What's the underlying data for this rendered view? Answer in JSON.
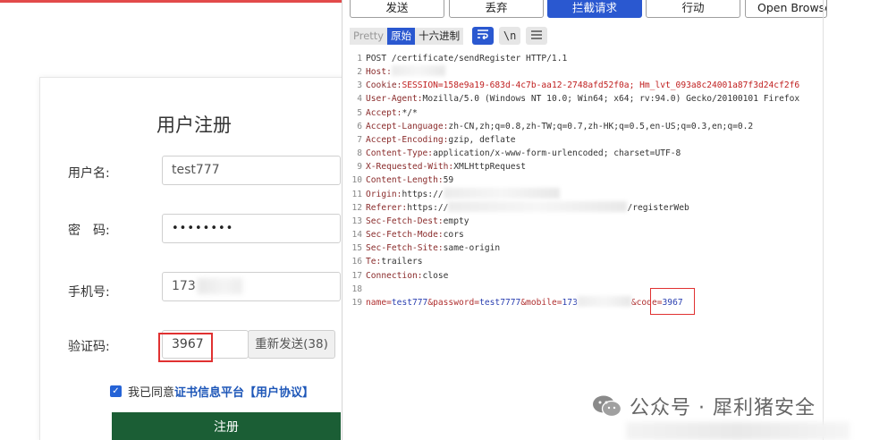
{
  "register": {
    "title": "用户注册",
    "username_label": "用户名:",
    "username_value": "test777",
    "password_label": "密　码:",
    "password_value": "••••••••",
    "mobile_label": "手机号:",
    "mobile_value": "173",
    "code_label": "验证码:",
    "code_value": "3967",
    "resend_label": "重新发送(38)",
    "agree_prefix": "我已同意",
    "agree_link": "证书信息平台【用户协议】",
    "submit_label": "注册"
  },
  "proxy": {
    "actions": [
      "发送",
      "丢弃",
      "拦截请求",
      "行动",
      "Open Browser"
    ],
    "view_tabs": [
      "Pretty",
      "原始",
      "十六进制"
    ],
    "view_icons": [
      "wrap-icon",
      "newline-icon",
      "menu-icon"
    ],
    "newline_glyph": "\\n",
    "request_lines": [
      {
        "n": "1",
        "key": "",
        "value": "POST /certificate/sendRegister HTTP/1.1"
      },
      {
        "n": "2",
        "key": "Host:",
        "value": ""
      },
      {
        "n": "3",
        "key": "Cookie:",
        "value": "SESSION=158e9a19-683d-4c7b-aa12-2748afd52f0a; Hm_lvt_093a8c24001a87f3d24cf2f6"
      },
      {
        "n": "4",
        "key": "User-Agent:",
        "value": "Mozilla/5.0 (Windows NT 10.0; Win64; x64; rv:94.0) Gecko/20100101 Firefox"
      },
      {
        "n": "5",
        "key": "Accept:",
        "value": "*/*"
      },
      {
        "n": "6",
        "key": "Accept-Language:",
        "value": "zh-CN,zh;q=0.8,zh-TW;q=0.7,zh-HK;q=0.5,en-US;q=0.3,en;q=0.2"
      },
      {
        "n": "7",
        "key": "Accept-Encoding:",
        "value": "gzip, deflate"
      },
      {
        "n": "8",
        "key": "Content-Type:",
        "value": "application/x-www-form-urlencoded; charset=UTF-8"
      },
      {
        "n": "9",
        "key": "X-Requested-With:",
        "value": "XMLHttpRequest"
      },
      {
        "n": "10",
        "key": "Content-Length:",
        "value": "59"
      },
      {
        "n": "11",
        "key": "Origin:",
        "value": "https://"
      },
      {
        "n": "12",
        "key": "Referer:",
        "value": "https://",
        "tail": "/registerWeb"
      },
      {
        "n": "13",
        "key": "Sec-Fetch-Dest:",
        "value": "empty"
      },
      {
        "n": "14",
        "key": "Sec-Fetch-Mode:",
        "value": "cors"
      },
      {
        "n": "15",
        "key": "Sec-Fetch-Site:",
        "value": "same-origin"
      },
      {
        "n": "16",
        "key": "Te:",
        "value": "trailers"
      },
      {
        "n": "17",
        "key": "Connection:",
        "value": "close"
      },
      {
        "n": "18",
        "key": "",
        "value": ""
      }
    ],
    "body_line": {
      "n": "19",
      "name_key": "name=",
      "name_val": "test777",
      "pwd_key": "&password=",
      "pwd_val": "test7777",
      "mobile_key": "&mobile=",
      "mobile_val": "173",
      "code_key": "&code=",
      "code_val": "3967"
    }
  },
  "watermark": {
    "text": "公众号 · 犀利猪安全",
    "icon": "wechat-icon"
  },
  "colors": {
    "accent_blue": "#2a58d0",
    "submit_green": "#1b5e35",
    "highlight_red": "#e03131"
  }
}
